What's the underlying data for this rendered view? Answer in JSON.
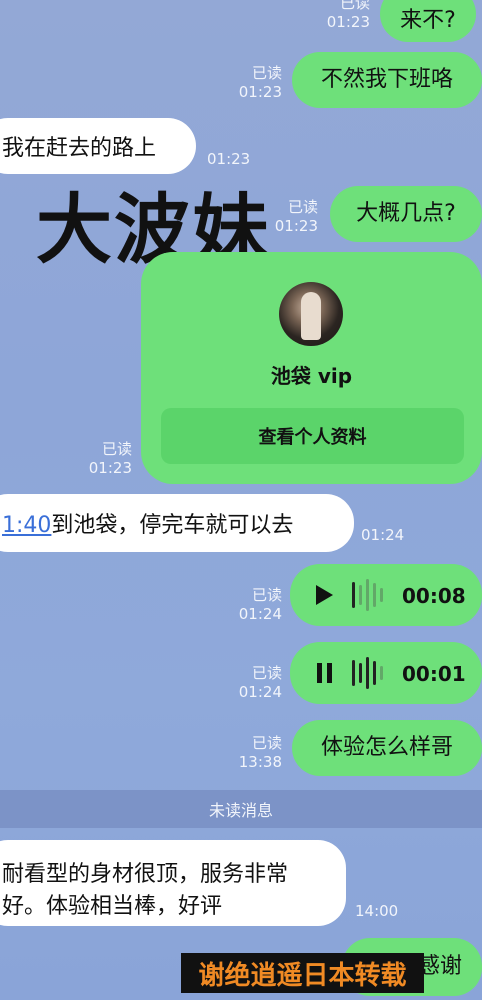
{
  "messages": {
    "m1": {
      "text": "来不?",
      "read": "已读",
      "time": "01:23"
    },
    "m2": {
      "text": "不然我下班咯",
      "read": "已读",
      "time": "01:23"
    },
    "m3": {
      "text": "我在赶去的路上",
      "time": "01:23"
    },
    "m4": {
      "text": "大概几点?",
      "read": "已读",
      "time": "01:23"
    },
    "m5": {
      "read": "已读",
      "time": "01:23"
    },
    "m6": {
      "link": "1:40",
      "text": "到池袋，停完车就可以去",
      "time": "01:24"
    },
    "m7": {
      "read": "已读",
      "time": "01:24",
      "duration": "00:08",
      "icon": "play-icon"
    },
    "m8": {
      "read": "已读",
      "time": "01:24",
      "duration": "00:01",
      "icon": "pause-icon"
    },
    "m9": {
      "text": "体验怎么样哥",
      "read": "已读",
      "time": "13:38"
    },
    "m10": {
      "line1": "耐看型的身材很顶，服务非常",
      "line2": "好。体验相当棒，好评",
      "time": "14:00"
    },
    "m11": {
      "text": "感谢"
    }
  },
  "overlay": {
    "title": "大波妹"
  },
  "card": {
    "name": "池袋 vip",
    "button": "查看个人资料"
  },
  "divider": {
    "label": "未读消息"
  },
  "watermark": {
    "text": "谢绝逍遥日本转载"
  },
  "colors": {
    "out_bubble": "#6ee07a",
    "in_bubble": "#ffffff",
    "background": "#8fa9da",
    "link": "#3a6fd8",
    "watermark": "#f08a24"
  }
}
